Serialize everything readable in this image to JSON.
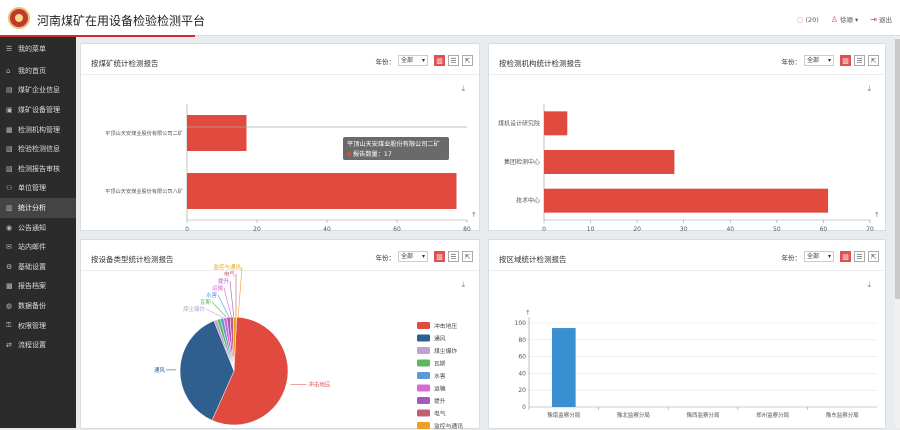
{
  "app": {
    "title": "河南煤矿在用设备检验检测平台",
    "msg_count": "(20)",
    "user": "徐顺",
    "logout": "退出"
  },
  "sidebar": {
    "items": [
      {
        "label": "我的菜单",
        "icon": "menu-icon"
      },
      {
        "label": "我的首页",
        "icon": "home-icon"
      },
      {
        "label": "煤矿企业信息",
        "icon": "chart-icon"
      },
      {
        "label": "煤矿设备管理",
        "icon": "device-icon"
      },
      {
        "label": "检测机构管理",
        "icon": "building-icon"
      },
      {
        "label": "检验检测信息",
        "icon": "doc-icon"
      },
      {
        "label": "检测报告审核",
        "icon": "audit-icon"
      },
      {
        "label": "单位管理",
        "icon": "org-icon"
      },
      {
        "label": "统计分析",
        "icon": "stats-icon"
      },
      {
        "label": "公告通知",
        "icon": "notice-icon"
      },
      {
        "label": "站内邮件",
        "icon": "mail-icon"
      },
      {
        "label": "基础设置",
        "icon": "gear-icon"
      },
      {
        "label": "报告档案",
        "icon": "archive-icon"
      },
      {
        "label": "数据备份",
        "icon": "backup-icon"
      },
      {
        "label": "权限管理",
        "icon": "lock-icon"
      },
      {
        "label": "流程设置",
        "icon": "flow-icon"
      }
    ]
  },
  "panels": [
    {
      "title": "按煤矿统计检测报告",
      "filter_label": "年份：",
      "filter_value": "全部"
    },
    {
      "title": "按检测机构统计检测报告",
      "filter_label": "年份：",
      "filter_value": "全部"
    },
    {
      "title": "按设备类型统计检测报告",
      "filter_label": "年份：",
      "filter_value": "全部"
    },
    {
      "title": "按区域统计检测报告",
      "filter_label": "年份：",
      "filter_value": "全部"
    }
  ],
  "tooltip": {
    "title": "平顶山天安煤业股份有限公司二矿",
    "label": "报告数量：17"
  },
  "chart_data": [
    {
      "type": "bar",
      "orientation": "horizontal",
      "categories": [
        "平顶山天安煤业股份有限公司八矿",
        "平顶山天安煤业股份有限公司二矿"
      ],
      "values": [
        77,
        17
      ],
      "xlim": [
        0,
        80
      ],
      "xticks": [
        "0",
        "20",
        "40",
        "60",
        "80"
      ],
      "color": "#e04a3f"
    },
    {
      "type": "bar",
      "orientation": "horizontal",
      "categories": [
        "技术中心",
        "集团检测中心",
        "煤机设计研究院"
      ],
      "values": [
        61,
        28,
        5
      ],
      "xlim": [
        0,
        70
      ],
      "xticks": [
        "0",
        "10",
        "20",
        "30",
        "40",
        "50",
        "60",
        "70"
      ],
      "color": "#e04a3f"
    },
    {
      "type": "pie",
      "categories": [
        "冲击地压",
        "通风",
        "煤尘爆炸",
        "瓦斯",
        "水害",
        "运输",
        "提升",
        "电气",
        "监控与通讯"
      ],
      "values": [
        57,
        38,
        1,
        1,
        1,
        1,
        1,
        1,
        1
      ],
      "colors": [
        "#e04a3f",
        "#2f5f8f",
        "#c0a0d0",
        "#5cb85c",
        "#5b9bd5",
        "#d96ad0",
        "#a855c8",
        "#c06070",
        "#f0a020"
      ],
      "legend_position": "right"
    },
    {
      "type": "bar",
      "categories": [
        "豫南监察分局",
        "豫北监察分局",
        "豫西监察分局",
        "郑州监察分局",
        "豫东监察分局"
      ],
      "values": [
        94,
        0,
        0,
        0,
        0
      ],
      "ylim": [
        0,
        100
      ],
      "yticks": [
        "0",
        "20",
        "40",
        "60",
        "80",
        "100"
      ],
      "color": "#3a8fd0"
    }
  ]
}
